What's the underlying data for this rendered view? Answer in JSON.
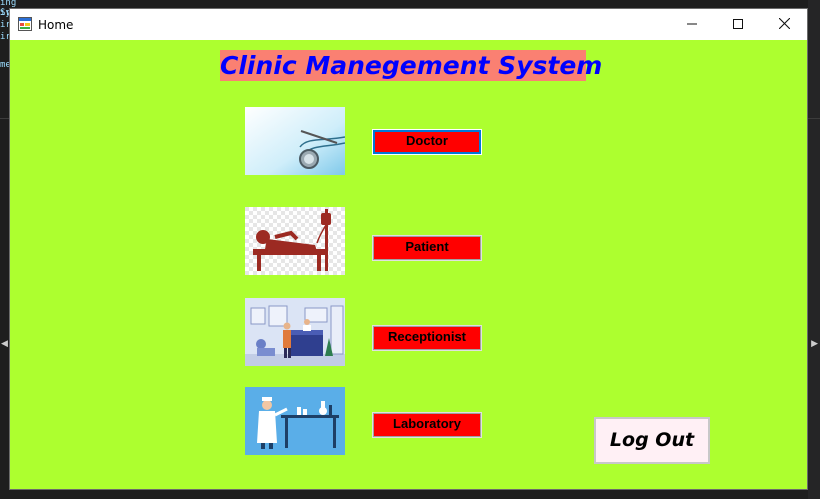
{
  "window": {
    "title": "Home",
    "controls": {
      "minimize": "—",
      "maximize": "☐",
      "close": "✕"
    }
  },
  "app": {
    "heading": "Clinic Manegement System"
  },
  "menu": [
    {
      "label": "Doctor",
      "image": "stethoscope-image"
    },
    {
      "label": "Patient",
      "image": "patient-bed-image"
    },
    {
      "label": "Receptionist",
      "image": "reception-desk-image"
    },
    {
      "label": "Laboratory",
      "image": "lab-scientist-image"
    }
  ],
  "logout": {
    "label": "Log Out"
  },
  "colors": {
    "form_background": "#adff2f",
    "heading_background": "#fa8072",
    "heading_text": "#0000ff",
    "nav_button": "#ff0000",
    "logout_button": "#fff0f5"
  },
  "background_code": [
    "ing System;",
    "ir",
    "ir",
    "ir",
    "me"
  ]
}
